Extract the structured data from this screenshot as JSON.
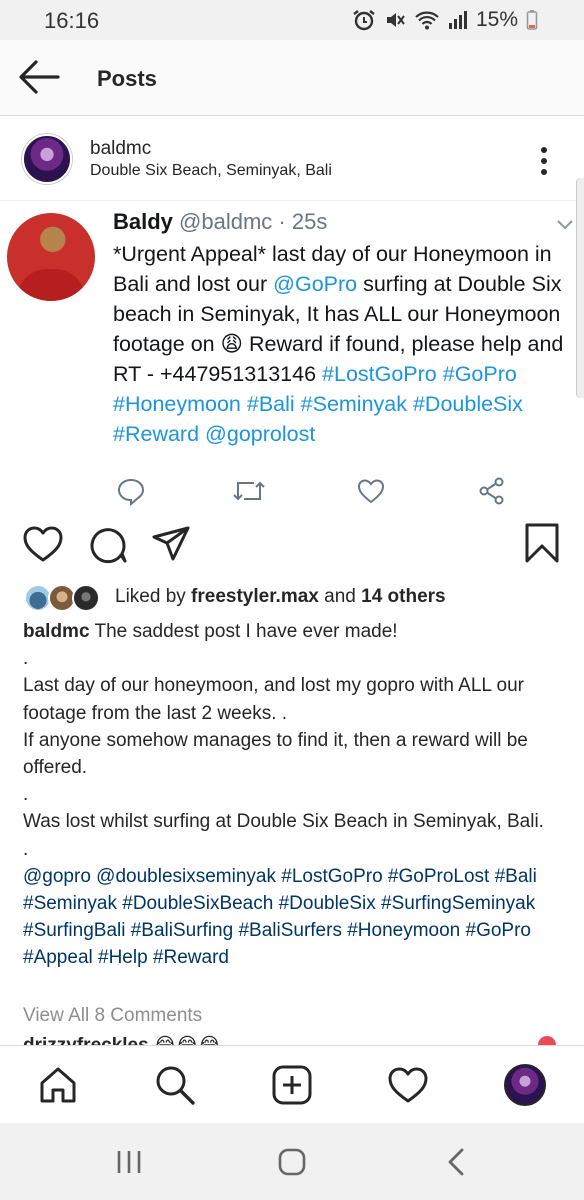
{
  "status_bar": {
    "time": "16:16",
    "battery": "15%",
    "icons": [
      "alarm-icon",
      "mute-icon",
      "wifi-icon",
      "signal-icon",
      "battery-icon"
    ]
  },
  "header": {
    "title": "Posts",
    "back_icon": "arrow-left-icon"
  },
  "post": {
    "username": "baldmc",
    "location": "Double Six Beach, Seminyak, Bali",
    "more_icon": "more-vertical-icon"
  },
  "tweet": {
    "name": "Baldy",
    "handle": "@baldmc",
    "time": " · 25s",
    "text_1": "*Urgent Appeal* last day of our Honeymoon in Bali and lost our ",
    "mention_1": "@GoPro",
    "text_2": "  surfing at Double Six beach in Seminyak,  It has ALL our Honeymoon footage on ",
    "emoji": "😩",
    "text_3": " Reward if found, please help and RT - +447951313146",
    "hashtags": "#LostGoPro #GoPro #Honeymoon #Bali #Seminyak #DoubleSix #Reward",
    "mention_2": "@goprolost",
    "actions": [
      "reply-icon",
      "retweet-icon",
      "like-icon",
      "share-icon"
    ]
  },
  "post_actions": {
    "icons": [
      "heart-icon",
      "comment-icon",
      "send-icon",
      "bookmark-icon"
    ]
  },
  "likes": {
    "prefix": "Liked by ",
    "user": "freestyler.max",
    "middle": " and ",
    "others": "14 others"
  },
  "caption": {
    "username": "baldmc",
    "line_1": " The saddest post I have ever made!",
    "dot_1": ".",
    "para_2": "Last day of our honeymoon, and lost my gopro with ALL our footage from the last 2 weeks. .",
    "para_3": "If anyone somehow manages to find it, then a reward will be offered.",
    "dot_2": ".",
    "para_4": "Was lost whilst surfing at Double Six Beach in Seminyak, Bali.",
    "dot_3": ".",
    "tags": "@gopro @doublesixseminyak #LostGoPro #GoProLost #Bali #Seminyak #DoubleSixBeach #DoubleSix #SurfingSeminyak #SurfingBali #BaliSurfing #BaliSurfers #Honeymoon #GoPro #Appeal #Help #Reward"
  },
  "comments": {
    "view_all": "View All 8 Comments",
    "peek": "drizzyfreckles 😂😂😂"
  },
  "bottom_nav": {
    "items": [
      "home-icon",
      "search-icon",
      "add-post-icon",
      "activity-heart-icon",
      "profile-avatar"
    ]
  },
  "system_nav": {
    "items": [
      "recents-icon",
      "home-circle-icon",
      "back-chevron-icon"
    ]
  },
  "colors": {
    "twitter_link": "#1b95e0",
    "instagram_tag": "#003569",
    "muted": "#8e8e8e",
    "notification_red": "#ed4956"
  }
}
